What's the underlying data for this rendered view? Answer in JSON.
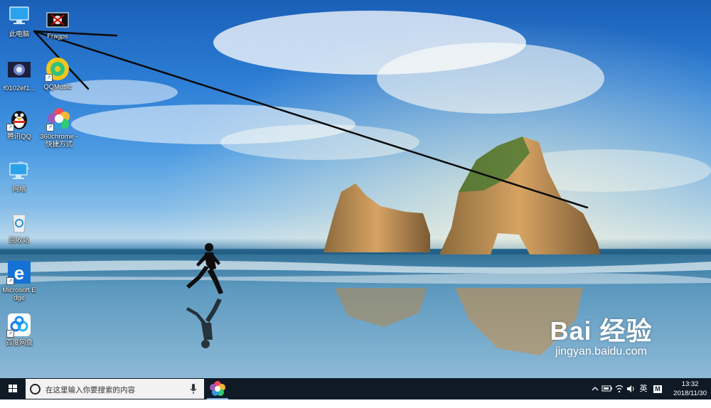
{
  "desktop": {
    "icons": [
      {
        "label": "此电脑",
        "icon": "this-pc-icon"
      },
      {
        "label": "Fragps",
        "icon": "app-icon"
      },
      {
        "label": "f0102ef1...",
        "icon": "video-file-icon"
      },
      {
        "label": "QQMusic",
        "icon": "qqmusic-icon"
      },
      {
        "label": "腾讯QQ",
        "icon": "qq-penguin-icon"
      },
      {
        "label": "360chrome - 快捷方式",
        "icon": "360chrome-icon"
      },
      {
        "label": "网络",
        "icon": "network-icon"
      },
      {
        "label": "回收站",
        "icon": "recycle-bin-icon"
      },
      {
        "label": "Microsoft Edge",
        "icon": "edge-icon"
      },
      {
        "label": "百度网盘",
        "icon": "baidu-netdisk-icon"
      }
    ]
  },
  "watermark": {
    "logo": "Bai  经验",
    "url": "jingyan.baidu.com"
  },
  "taskbar": {
    "search_placeholder": "在这里输入你要搜索的内容",
    "ime": "英",
    "ime_mode": "M",
    "time": "13:32",
    "date": "2018/11/30"
  }
}
